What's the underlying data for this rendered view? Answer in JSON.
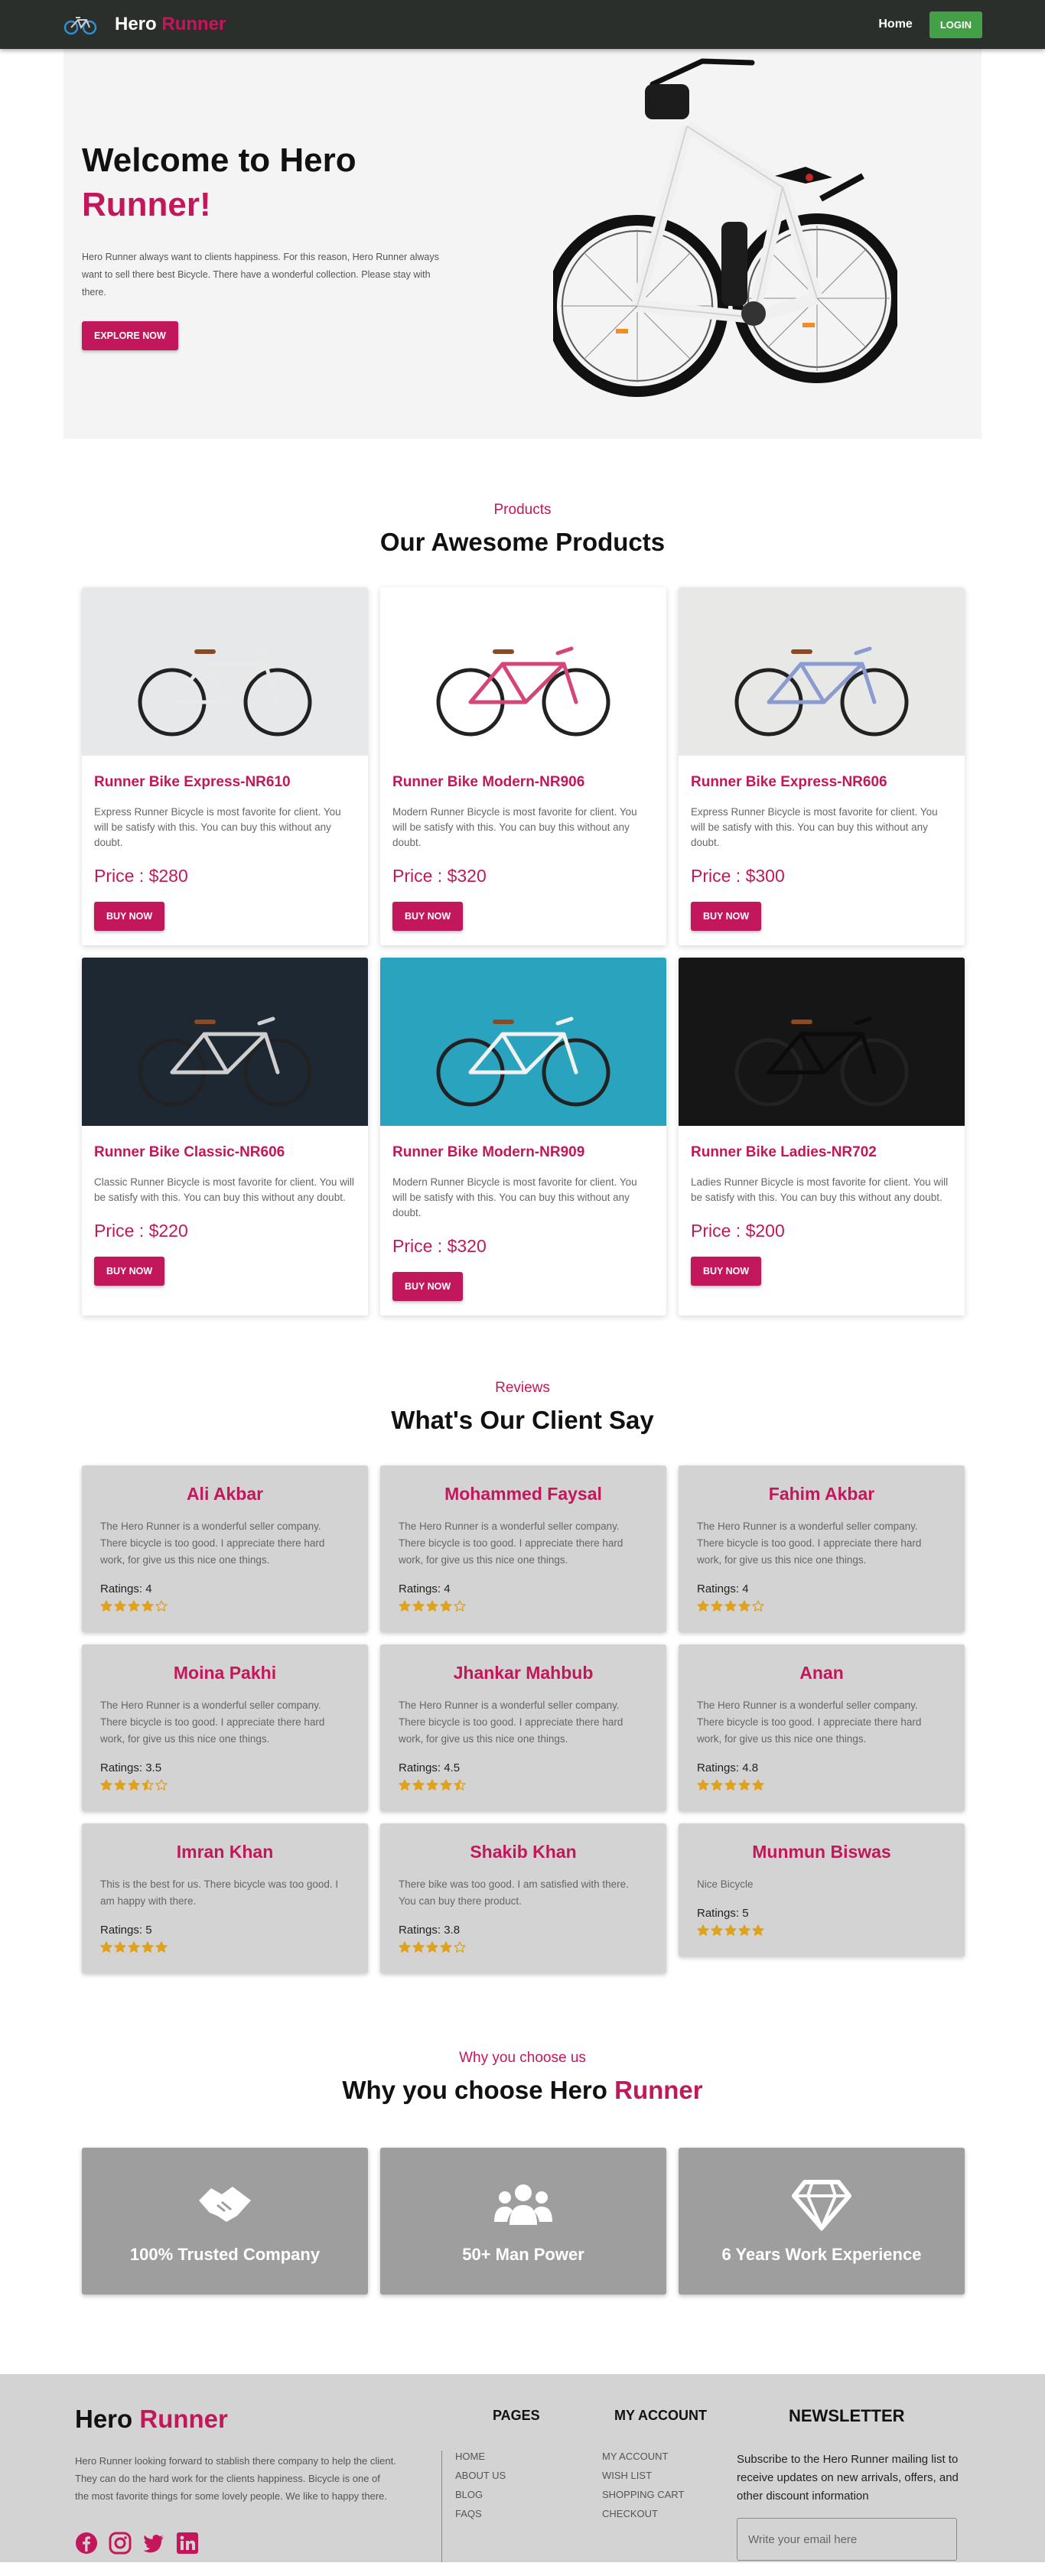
{
  "nav": {
    "brand_first": "Hero",
    "brand_second": "Runner",
    "links": [
      "Home"
    ],
    "login_label": "LOGIN"
  },
  "hero": {
    "title_line1": "Welcome to Hero",
    "title_line2": "Runner!",
    "description": "Hero Runner always want to clients happiness. For this reason, Hero Runner always want to sell there best Bicycle. There have a wonderful collection. Please stay with there.",
    "button_label": "EXPLORE NOW"
  },
  "products": {
    "kicker": "Products",
    "title": "Our Awesome Products",
    "items": [
      {
        "name": "Runner Bike Express-NR610",
        "description": "Express Runner Bicycle is most favorite for client. You will be satisfy with this. You can buy this without any doubt.",
        "price": "Price : $280",
        "button": "BUY NOW",
        "bg": "#e6e8ea",
        "frame": "#e9e9e9"
      },
      {
        "name": "Runner Bike Modern-NR906",
        "description": "Modern Runner Bicycle is most favorite for client. You will be satisfy with this. You can buy this without any doubt.",
        "price": "Price : $320",
        "button": "BUY NOW",
        "bg": "#ffffff",
        "frame": "#d6457a"
      },
      {
        "name": "Runner Bike Express-NR606",
        "description": "Express Runner Bicycle is most favorite for client. You will be satisfy with this. You can buy this without any doubt.",
        "price": "Price : $300",
        "button": "BUY NOW",
        "bg": "#e8e8e6",
        "frame": "#8a9ccf"
      },
      {
        "name": "Runner Bike Classic-NR606",
        "description": "Classic Runner Bicycle is most favorite for client. You will be satisfy with this. You can buy this without any doubt.",
        "price": "Price : $220",
        "button": "BUY NOW",
        "bg": "#1e2833",
        "frame": "#cfcfcf"
      },
      {
        "name": "Runner Bike Modern-NR909",
        "description": "Modern Runner Bicycle is most favorite for client. You will be satisfy with this. You can buy this without any doubt.",
        "price": "Price : $320",
        "button": "BUY NOW",
        "bg": "#2aa3bf",
        "frame": "#f2f2f2"
      },
      {
        "name": "Runner Bike Ladies-NR702",
        "description": "Ladies Runner Bicycle is most favorite for client. You will be satisfy with this. You can buy this without any doubt.",
        "price": "Price : $200",
        "button": "BUY NOW",
        "bg": "#161616",
        "frame": "#0b0b0b"
      }
    ]
  },
  "reviews": {
    "kicker": "Reviews",
    "title": "What's Our Client Say",
    "items": [
      {
        "name": "Ali Akbar",
        "text": "The Hero Runner is a wonderful seller company. There bicycle is too good. I appreciate there hard work, for give us this nice one things.",
        "ratings": "Ratings: 4",
        "rating_value": 4
      },
      {
        "name": "Mohammed Faysal",
        "text": "The Hero Runner is a wonderful seller company. There bicycle is too good. I appreciate there hard work, for give us this nice one things.",
        "ratings": "Ratings: 4",
        "rating_value": 4
      },
      {
        "name": "Fahim Akbar",
        "text": "The Hero Runner is a wonderful seller company. There bicycle is too good. I appreciate there hard work, for give us this nice one things.",
        "ratings": "Ratings: 4",
        "rating_value": 4
      },
      {
        "name": "Moina Pakhi",
        "text": "The Hero Runner is a wonderful seller company. There bicycle is too good. I appreciate there hard work, for give us this nice one things.",
        "ratings": "Ratings: 3.5",
        "rating_value": 3.5
      },
      {
        "name": "Jhankar Mahbub",
        "text": "The Hero Runner is a wonderful seller company. There bicycle is too good. I appreciate there hard work, for give us this nice one things.",
        "ratings": "Ratings: 4.5",
        "rating_value": 4.5
      },
      {
        "name": "Anan",
        "text": "The Hero Runner is a wonderful seller company. There bicycle is too good. I appreciate there hard work, for give us this nice one things.",
        "ratings": "Ratings: 4.8",
        "rating_value": 5
      },
      {
        "name": "Imran Khan",
        "text": "This is the best for us. There bicycle was too good. I am happy with there.",
        "ratings": "Ratings: 5",
        "rating_value": 5
      },
      {
        "name": "Shakib Khan",
        "text": "There bike was too good. I am satisfied with there. You can buy there product.",
        "ratings": "Ratings: 3.8",
        "rating_value": 4
      },
      {
        "name": "Munmun Biswas",
        "text": "Nice Bicycle",
        "ratings": "Ratings: 5",
        "rating_value": 5
      }
    ]
  },
  "why": {
    "kicker": "Why you choose us",
    "title_prefix": "Why you choose Hero",
    "title_accent": "Runner",
    "items": [
      {
        "icon": "handshake-icon",
        "label": "100% Trusted Company"
      },
      {
        "icon": "users-icon",
        "label": "50+ Man Power"
      },
      {
        "icon": "diamond-icon",
        "label": "6 Years Work Experience"
      }
    ]
  },
  "footer": {
    "brand_first": "Hero",
    "brand_second": "Runner",
    "about": "Hero Runner looking forward to stablish there company to help the client. They can do the hard work for the clients happiness. Bicycle is one of the most favorite things for some lovely people. We like to happy there.",
    "social": [
      "facebook-icon",
      "instagram-icon",
      "twitter-icon",
      "linkedin-icon"
    ],
    "pages_title": "PAGES",
    "pages": [
      "HOME",
      "ABOUT US",
      "BLOG",
      "FAQS"
    ],
    "account_title": "MY ACCOUNT",
    "account": [
      "MY ACCOUNT",
      "WISH LIST",
      "SHOPPING CART",
      "CHECKOUT"
    ],
    "newsletter_title": "NEWSLETTER",
    "newsletter_text": "Subscribe to the Hero Runner mailing list to receive updates on new arrivals, offers, and other discount information",
    "email_placeholder": "Write your email here"
  },
  "colors": {
    "accent": "#c2185b",
    "nav": "#2b2f2c",
    "login": "#43a047",
    "card_grey": "#d3d3d3",
    "why_card": "#9e9e9e",
    "star": "#e0a21b"
  }
}
